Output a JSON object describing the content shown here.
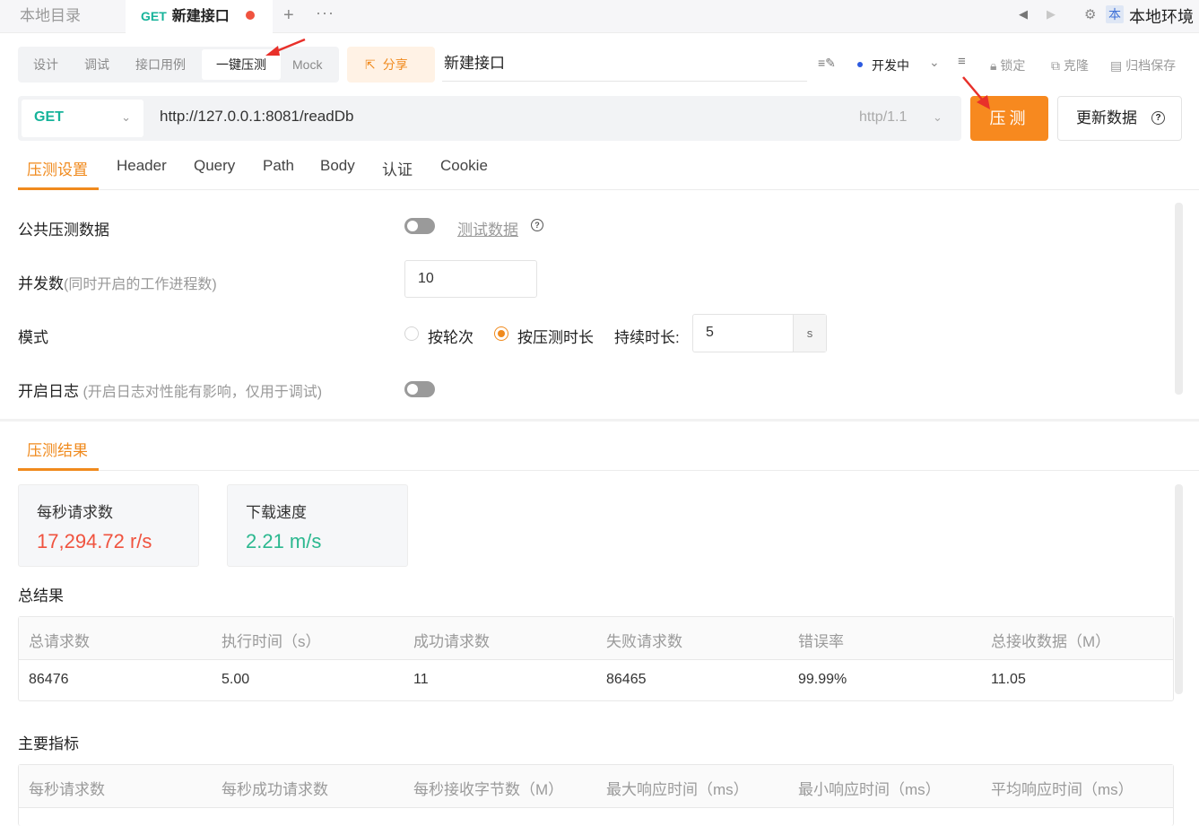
{
  "tabs": {
    "local_dir": "本地目录",
    "new_tab_method": "GET",
    "new_tab_title": "新建接口",
    "plus": "+",
    "more": "···"
  },
  "env": {
    "badge": "本",
    "name": "本地环境"
  },
  "mode_tabs": [
    "设计",
    "调试",
    "接口用例",
    "一键压测",
    "Mock"
  ],
  "active_mode_tab": "一键压测",
  "share_label": "分享",
  "api_name": "新建接口",
  "status": "开发中",
  "toolbar": {
    "lock": "锁定",
    "clone": "克隆",
    "save": "归档保存"
  },
  "request": {
    "method": "GET",
    "url": "http://127.0.0.1:8081/readDb",
    "protocol": "http/1.1",
    "run_label": "压测",
    "update_label": "更新数据"
  },
  "settings_tabs": [
    "压测设置",
    "Header",
    "Query",
    "Path",
    "Body",
    "认证",
    "Cookie"
  ],
  "settings": {
    "public_data_label": "公共压测数据",
    "test_data_link": "测试数据",
    "concurrency_label": "并发数",
    "concurrency_sub": "(同时开启的工作进程数)",
    "concurrency_value": "10",
    "mode_label": "模式",
    "mode_by_round": "按轮次",
    "mode_by_duration": "按压测时长",
    "duration_label": "持续时长:",
    "duration_value": "5",
    "duration_unit": "s",
    "log_label": "开启日志",
    "log_sub": " (开启日志对性能有影响，仅用于调试)"
  },
  "results": {
    "tab": "压测结果",
    "rps_label": "每秒请求数",
    "rps_value": "17,294.72 r/s",
    "download_label": "下载速度",
    "download_value": "2.21 m/s",
    "summary_title": "总结果",
    "summary_headers": [
      "总请求数",
      "执行时间（s）",
      "成功请求数",
      "失败请求数",
      "错误率",
      "总接收数据（M）"
    ],
    "summary_values": [
      "86476",
      "5.00",
      "11",
      "86465",
      "99.99%",
      "11.05"
    ],
    "metrics_title": "主要指标",
    "metrics_headers": [
      "每秒请求数",
      "每秒成功请求数",
      "每秒接收字节数（M）",
      "最大响应时间（ms）",
      "最小响应时间（ms）",
      "平均响应时间（ms）"
    ]
  },
  "colors": {
    "accent": "#f08a1d",
    "get_method": "#16b39a",
    "rps_value": "#f0533f",
    "download_value": "#2bb88f",
    "annotation_arrow": "#e8302a"
  }
}
